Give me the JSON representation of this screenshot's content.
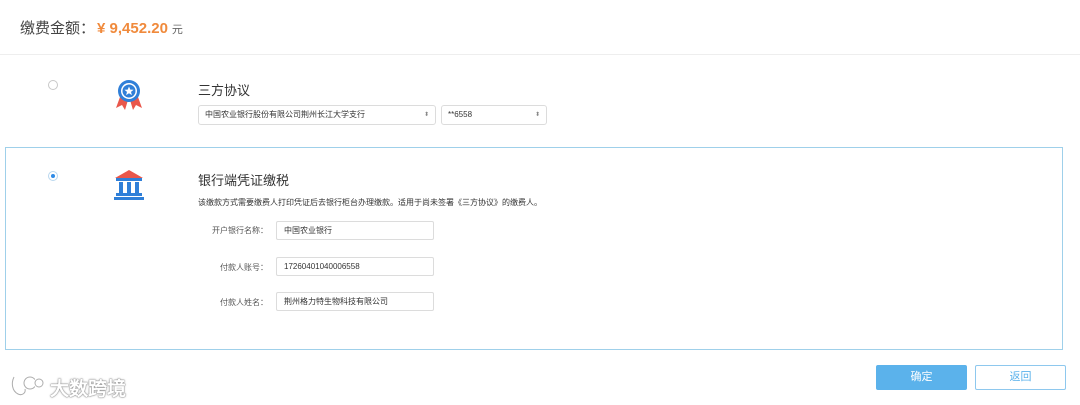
{
  "payment": {
    "label": "缴费金额：",
    "currency_symbol": "¥",
    "amount": "9,452.20",
    "unit": "元"
  },
  "option_tripartite": {
    "title": "三方协议",
    "bank_select": "中国农业银行股份有限公司荆州长江大学支行",
    "account_select": "**6558",
    "icon": "award-ribbon-icon",
    "selected": false
  },
  "option_bank_voucher": {
    "title": "银行端凭证缴税",
    "description": "该缴款方式需要缴费人打印凭证后去银行柜台办理缴款。适用于尚未签署《三方协议》的缴费人。",
    "icon": "bank-building-icon",
    "selected": true,
    "fields": {
      "bank_name_label": "开户银行名称：",
      "bank_name_value": "中国农业银行",
      "account_label": "付款人账号：",
      "account_value": "17260401040006558",
      "payer_label": "付款人姓名：",
      "payer_value": "荆州格力特生物科技有限公司"
    }
  },
  "actions": {
    "confirm": "确定",
    "back": "返回"
  },
  "watermark": {
    "text": "大数跨境"
  },
  "colors": {
    "amount": "#f08a3c",
    "accent": "#5bb2eb",
    "panel_border": "#9fd0ea"
  }
}
